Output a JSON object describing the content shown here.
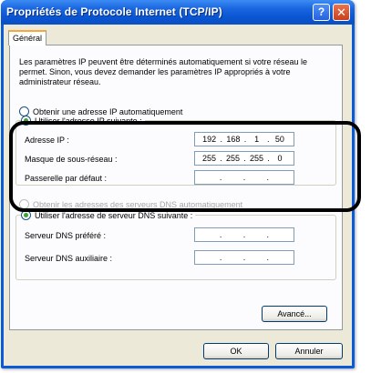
{
  "window": {
    "title": "Propriétés de Protocole Internet (TCP/IP)",
    "help_label": "?",
    "close_label": "✕"
  },
  "tabs": [
    {
      "label": "Général"
    }
  ],
  "description": "Les paramètres IP peuvent être déterminés automatiquement si votre réseau le permet. Sinon, vous devez demander les paramètres IP appropriés à votre administrateur réseau.",
  "ip_mode": {
    "auto_label": "Obtenir une adresse IP automatiquement",
    "manual_label": "Utiliser l'adresse IP suivante :",
    "selected": "manual"
  },
  "ip_fields": [
    {
      "label": "Adresse IP :",
      "octets": [
        "192",
        "168",
        "1",
        "50"
      ]
    },
    {
      "label": "Masque de sous-réseau :",
      "octets": [
        "255",
        "255",
        "255",
        "0"
      ]
    },
    {
      "label": "Passerelle par défaut :",
      "octets": [
        "",
        "",
        "",
        ""
      ]
    }
  ],
  "dns_mode": {
    "auto_label": "Obtenir les adresses des serveurs DNS automatiquement",
    "manual_label": "Utiliser l'adresse de serveur DNS suivante :",
    "selected": "manual",
    "auto_disabled": true
  },
  "dns_fields": [
    {
      "label": "Serveur DNS préféré :",
      "octets": [
        "",
        "",
        "",
        ""
      ]
    },
    {
      "label": "Serveur DNS auxiliaire :",
      "octets": [
        "",
        "",
        "",
        ""
      ]
    }
  ],
  "buttons": {
    "advanced": "Avancé...",
    "ok": "OK",
    "cancel": "Annuler"
  },
  "colors": {
    "titlebar": "#0a55d2",
    "dialog_bg": "#ece9d8",
    "tab_accent": "#f5a93a",
    "radio_checked": "#3aa534",
    "highlight_outline": "#000000"
  }
}
